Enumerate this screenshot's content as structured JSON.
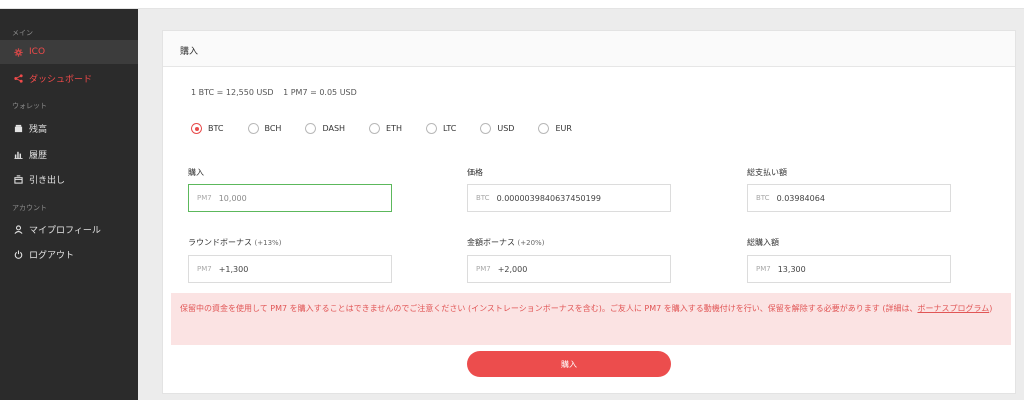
{
  "sidebar": {
    "section_main": "メイン",
    "section_wallet": "ウォレット",
    "section_account": "アカウント",
    "items": [
      {
        "label": "ICO",
        "icon": "gear-icon",
        "state": "active"
      },
      {
        "label": "ダッシュボード",
        "icon": "share-icon",
        "state": "highlight"
      },
      {
        "label": "残高",
        "icon": "wallet-icon"
      },
      {
        "label": "履歴",
        "icon": "chart-icon"
      },
      {
        "label": "引き出し",
        "icon": "withdraw-icon"
      },
      {
        "label": "マイプロフィール",
        "icon": "user-icon"
      },
      {
        "label": "ログアウト",
        "icon": "power-icon"
      }
    ]
  },
  "card": {
    "title": "購入",
    "rate_btc": "1 BTC = 12,550 USD",
    "rate_pm7": "1 PM7 = 0.05 USD"
  },
  "currencies": {
    "options": [
      "BTC",
      "BCH",
      "DASH",
      "ETH",
      "LTC",
      "USD",
      "EUR"
    ],
    "selected": "BTC"
  },
  "form": {
    "purchase_label": "購入",
    "purchase_prefix": "PM7",
    "purchase_value": "10,000",
    "price_label": "価格",
    "price_prefix": "BTC",
    "price_value": "0.0000039840637450199",
    "total_pay_label": "総支払い額",
    "total_pay_prefix": "BTC",
    "total_pay_value": "0.03984064",
    "round_bonus_label": "ラウンドボーナス",
    "round_bonus_pct": "(+13%)",
    "round_bonus_prefix": "PM7",
    "round_bonus_value": "+1,300",
    "amount_bonus_label": "金額ボーナス",
    "amount_bonus_pct": "(+20%)",
    "amount_bonus_prefix": "PM7",
    "amount_bonus_value": "+2,000",
    "total_buy_label": "総購入額",
    "total_buy_prefix": "PM7",
    "total_buy_value": "13,300"
  },
  "notice": {
    "text": "保留中の資金を使用して PM7 を購入することはできませんのでご注意ください (インストレーションボーナスを含む)。ご友人に PM7 を購入する動機付けを行い、保留を解除する必要があります (詳細は、",
    "link": "ボーナスプログラム",
    "suffix": ")"
  },
  "buy_button": "購入",
  "colors": {
    "accent": "#ec4d4d",
    "sidebar_bg": "#2b2b2b",
    "notice_bg": "#fbe3e3",
    "focus_border": "#5cb85c"
  }
}
